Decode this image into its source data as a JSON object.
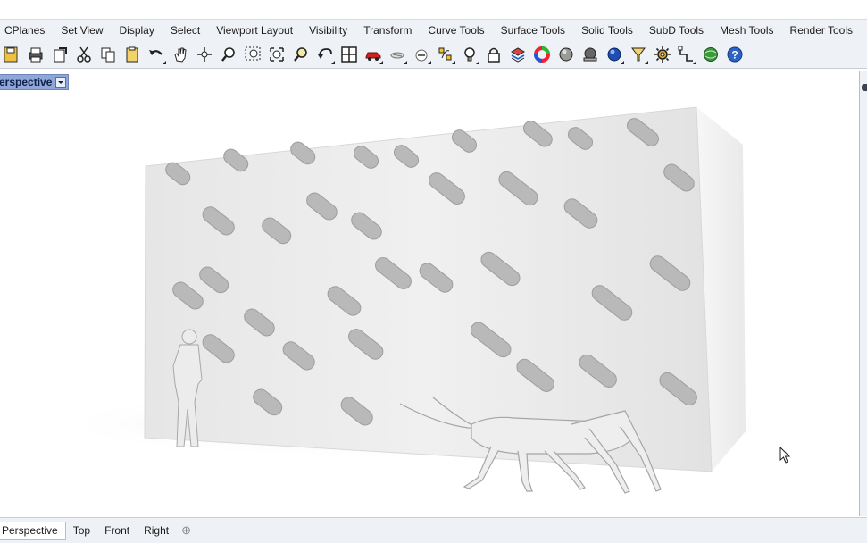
{
  "menu": {
    "tabs": [
      "CPlanes",
      "Set View",
      "Display",
      "Select",
      "Viewport Layout",
      "Visibility",
      "Transform",
      "Curve Tools",
      "Surface Tools",
      "Solid Tools",
      "SubD Tools",
      "Mesh Tools",
      "Render Tools"
    ]
  },
  "toolbar": {
    "icons": [
      "save-icon",
      "print-icon",
      "import-icon",
      "cut-icon",
      "copy-icon",
      "paste-icon",
      "undo-icon",
      "pan-hand-icon",
      "move-view-icon",
      "zoom-icon",
      "zoom-window-icon",
      "zoom-extents-icon",
      "zoom-selected-icon",
      "rotate-view-icon",
      "viewport-layout-icon",
      "car-icon",
      "hide-icon",
      "lock-icon",
      "points-icon",
      "light-bulb-icon",
      "padlock-icon",
      "layer-icon",
      "color-wheel-icon",
      "shaded-sphere-icon",
      "rendered-sphere-icon",
      "blue-sphere-icon",
      "filter-icon",
      "settings-gear-icon",
      "snap-icon",
      "globe-icon",
      "help-icon"
    ]
  },
  "viewport": {
    "title": "Perspective"
  },
  "bottom_tabs": {
    "perspective": "Perspective",
    "top": "Top",
    "front": "Front",
    "right": "Right",
    "add": "⊕"
  }
}
